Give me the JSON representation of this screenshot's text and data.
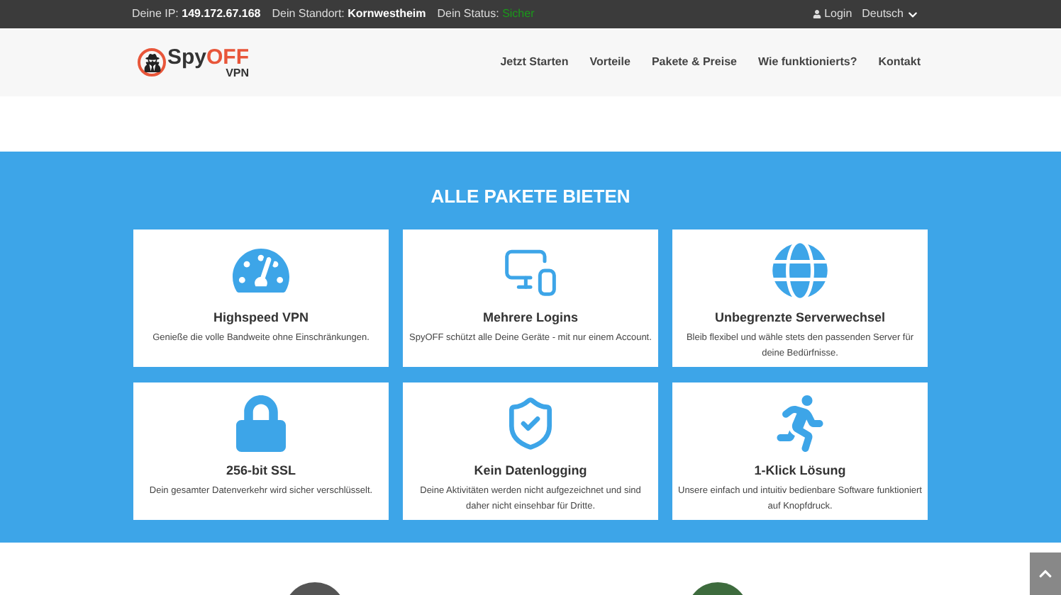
{
  "topbar": {
    "ip_label": "Deine IP:",
    "ip": "149.172.67.168",
    "location_label": "Dein Standort:",
    "location": "Kornwestheim",
    "status_label": "Dein Status:",
    "status": "Sicher",
    "login": "Login",
    "language": "Deutsch"
  },
  "logo": {
    "part_1": "Spy",
    "part_2": "OFF",
    "part_3": "VPN"
  },
  "nav": [
    "Jetzt Starten",
    "Vorteile",
    "Pakete & Preise",
    "Wie funktionierts?",
    "Kontakt"
  ],
  "features": {
    "title": "ALLE PAKETE BIETEN",
    "cards": [
      {
        "kind": "speed",
        "title": "Highspeed VPN",
        "text": "Genieße die volle Bandweite ohne Einschränkungen."
      },
      {
        "kind": "devices",
        "title": "Mehrere Logins",
        "text": "SpyOFF schützt alle Deine Geräte - mit nur einem Account."
      },
      {
        "kind": "globe",
        "title": "Unbegrenzte Serverwechsel",
        "text": "Bleib flexibel und wähle stets den passenden Server für deine Bedürfnisse."
      },
      {
        "kind": "lock",
        "title": "256-bit SSL",
        "text": "Dein gesamter Datenverkehr wird sicher verschlüsselt."
      },
      {
        "kind": "shield",
        "title": "Kein Datenlogging",
        "text": "Deine Aktivitäten werden nicht aufgezeichnet und sind daher nicht einsehbar für Dritte."
      },
      {
        "kind": "runner",
        "title": "1-Klick Lösung",
        "text": "Unsere einfach und intuitiv bedienbare Software funktioniert auf Knopfdruck."
      }
    ]
  }
}
